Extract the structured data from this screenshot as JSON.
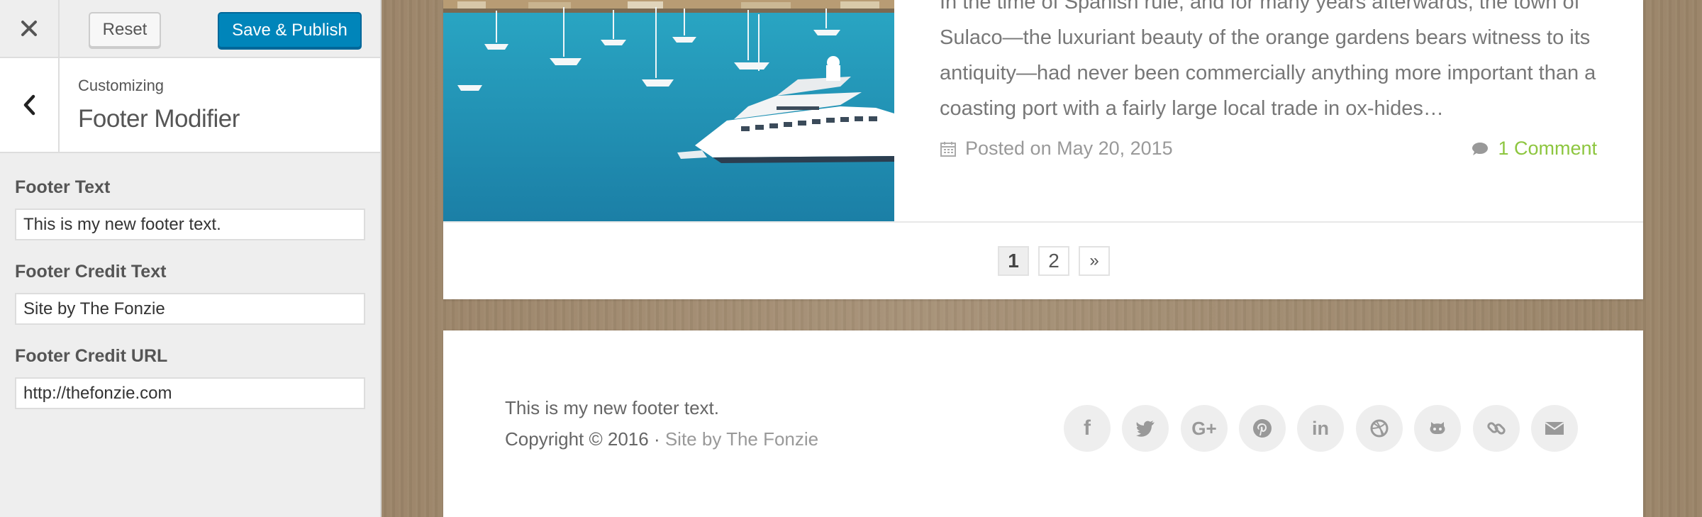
{
  "customizer": {
    "reset_label": "Reset",
    "publish_label": "Save & Publish",
    "section_context": "Customizing",
    "section_title": "Footer Modifier",
    "fields": [
      {
        "label": "Footer Text",
        "value": "This is my new footer text."
      },
      {
        "label": "Footer Credit Text",
        "value": "Site by The Fonzie"
      },
      {
        "label": "Footer Credit URL",
        "value": "http://thefonzie.com"
      }
    ],
    "colors": {
      "primary_button": "#0085ba",
      "sidebar_bg": "#eeeeee"
    }
  },
  "preview": {
    "post": {
      "excerpt_lines": [
        "In the time of Spanish rule, and for many years afterwards, the town of",
        "Sulaco—the luxuriant beauty of the orange gardens bears witness to its",
        "antiquity—had never been commercially anything more important than a",
        "coasting port with a fairly large local trade in ox-hides…"
      ],
      "posted_on": "Posted on May 20, 2015",
      "comments": "1 Comment",
      "accent_color": "#8dc63f"
    },
    "pagination": [
      "1",
      "2",
      "»"
    ],
    "footer": {
      "text": "This is my new footer text.",
      "copyright_prefix": "Copyright © 2016 · ",
      "credit_text": "Site by The Fonzie",
      "social_icons": [
        "facebook-icon",
        "twitter-icon",
        "google-plus-icon",
        "pinterest-icon",
        "linkedin-icon",
        "dribbble-icon",
        "github-icon",
        "link-icon",
        "email-icon"
      ],
      "social_labels": [
        "f",
        "G+",
        "in"
      ]
    }
  }
}
